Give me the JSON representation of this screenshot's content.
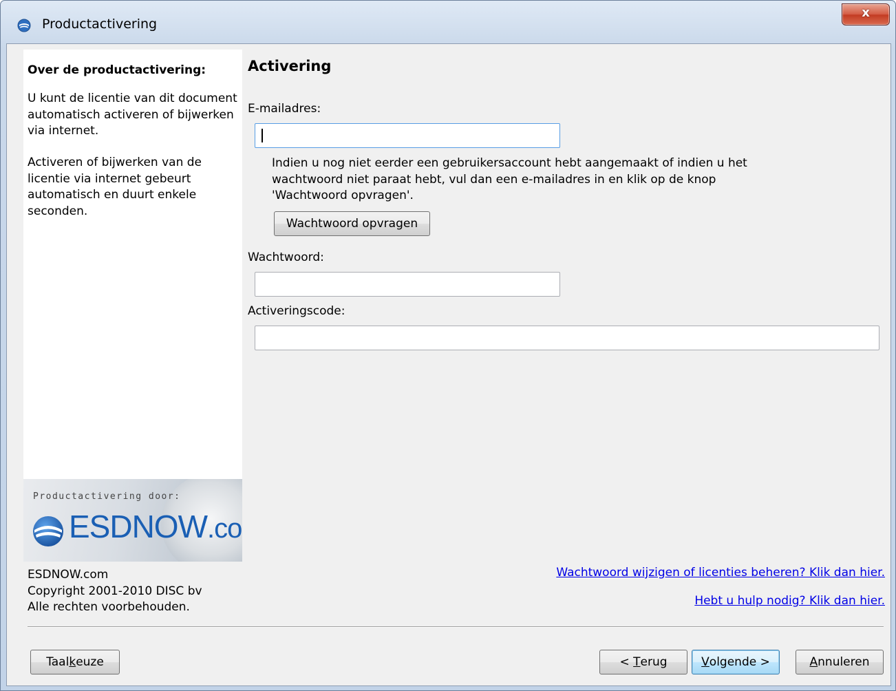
{
  "window": {
    "title": "Productactivering",
    "close_label": "x"
  },
  "sidebar": {
    "heading": "Over de productactivering:",
    "paragraph1": "U kunt de licentie van dit document automatisch activeren of bijwerken via internet.",
    "paragraph2": "Activeren of bijwerken van de licentie via internet gebeurt automatisch en duurt enkele seconden.",
    "logo_caption": "Productactivering door:",
    "logo_name": "ESDNOW",
    "logo_suffix": ".com",
    "company": "ESDNOW.com",
    "copyright": "Copyright 2001-2010 DISC bv",
    "rights": "Alle rechten voorbehouden."
  },
  "main": {
    "title": "Activering",
    "email_label": "E-mailadres:",
    "email_value": "",
    "info_text": "Indien u nog niet eerder een gebruikersaccount hebt aangemaakt of indien u het wachtwoord niet paraat hebt, vul dan een e-mailadres in en klik op de knop 'Wachtwoord opvragen'.",
    "request_password_button": "Wachtwoord opvragen",
    "password_label": "Wachtwoord:",
    "password_value": "",
    "code_label": "Activeringscode:",
    "code_value": "",
    "link_manage": "Wachtwoord wijzigen of licenties beheren? Klik dan hier.",
    "link_help": "Hebt u hulp nodig? Klik dan hier."
  },
  "buttons": {
    "language": {
      "pre": "Taal",
      "accel": "k",
      "post": "euze"
    },
    "back": {
      "pre": "< ",
      "accel": "T",
      "post": "erug"
    },
    "next": {
      "pre": "",
      "accel": "V",
      "post": "olgende >"
    },
    "cancel": {
      "pre": "",
      "accel": "A",
      "post": "nnuleren"
    }
  },
  "colors": {
    "accent": "#1a5fb4",
    "link": "#0000e6",
    "close_button": "#c23b22",
    "default_button_border": "#3c7fb1"
  },
  "icons": {
    "title": "esdnow-logo-icon",
    "close": "close-icon"
  }
}
